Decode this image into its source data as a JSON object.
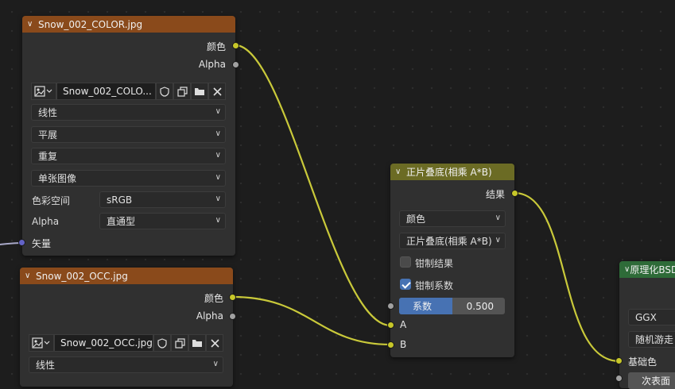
{
  "colors": {
    "wire": "#c9c93a",
    "tex_header": "#8a4a1b",
    "mix_header": "#6b6b24",
    "bsdf_header": "#2e6b38",
    "accent": "#4772b3"
  },
  "tex_color": {
    "title": "Snow_002_COLOR.jpg",
    "out_color": "颜色",
    "out_alpha": "Alpha",
    "image_name": "Snow_002_COLO...",
    "interpolation": "线性",
    "projection": "平展",
    "extension": "重复",
    "source": "单张图像",
    "colorspace_label": "色彩空间",
    "colorspace_value": "sRGB",
    "alpha_label": "Alpha",
    "alpha_value": "直通型",
    "in_vector": "矢量"
  },
  "tex_occ": {
    "title": "Snow_002_OCC.jpg",
    "out_color": "颜色",
    "out_alpha": "Alpha",
    "image_name": "Snow_002_OCC.jpg",
    "interpolation": "线性"
  },
  "mix": {
    "title": "正片叠底(相乘 A*B)",
    "out_result": "结果",
    "data_type": "颜色",
    "blend_mode": "正片叠底(相乘 A*B)",
    "clamp_result_label": "钳制结果",
    "clamp_result_checked": false,
    "clamp_factor_label": "钳制系数",
    "clamp_factor_checked": true,
    "factor_label": "系数",
    "factor_value": "0.500",
    "factor_fraction": 0.5,
    "in_a": "A",
    "in_b": "B"
  },
  "bsdf": {
    "title": "原理化BSDF",
    "distribution": "GGX",
    "subsurface": "随机游走",
    "in_base_color": "基础色",
    "next_label": "次表面"
  }
}
